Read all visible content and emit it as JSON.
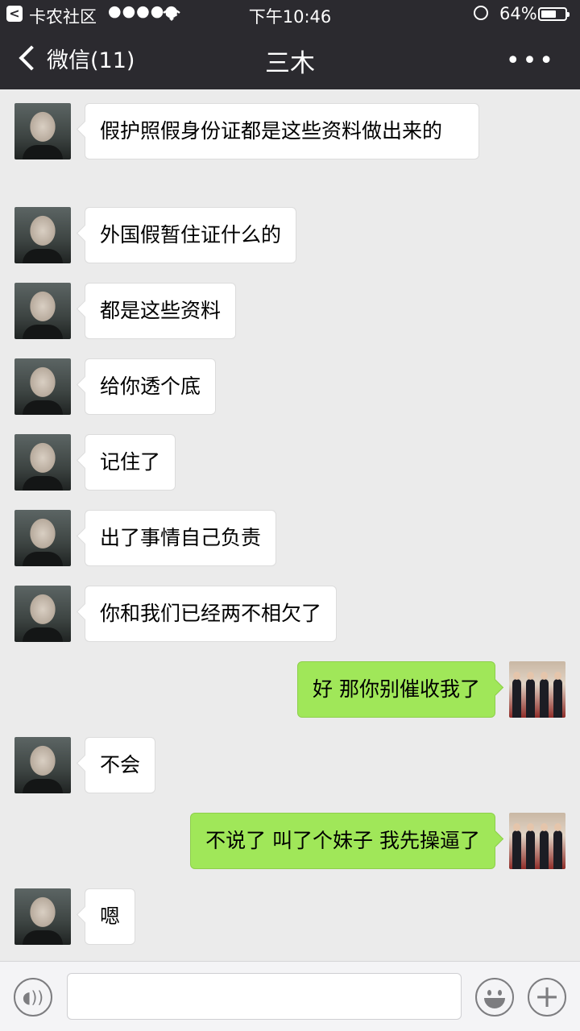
{
  "status_bar": {
    "back_app": "<",
    "carrier": "卡农社区",
    "signal": "●●●●●",
    "wifi": "wifi-icon",
    "time": "下午10:46",
    "battery_percent": "64%",
    "battery_level": 0.64
  },
  "nav": {
    "back_label": "微信(11)",
    "title": "三木",
    "more_label": "•••"
  },
  "messages": [
    {
      "side": "left",
      "text": "假护照假身份证都是这些资料做出来的"
    },
    {
      "side": "left",
      "text": "外国假暂住证什么的"
    },
    {
      "side": "left",
      "text": "都是这些资料"
    },
    {
      "side": "left",
      "text": "给你透个底"
    },
    {
      "side": "left",
      "text": "记住了"
    },
    {
      "side": "left",
      "text": "出了事情自己负责"
    },
    {
      "side": "left",
      "text": "你和我们已经两不相欠了"
    },
    {
      "side": "right",
      "text": "好 那你别催收我了"
    },
    {
      "side": "left",
      "text": "不会"
    },
    {
      "side": "right",
      "text": "不说了 叫了个妹子 我先操逼了"
    },
    {
      "side": "left",
      "text": "嗯"
    }
  ],
  "input_bar": {
    "voice_icon": "voice-icon",
    "voice_glyph": "◖))",
    "input_value": "",
    "emoji_icon": "emoji-icon",
    "plus_icon": "plus-icon",
    "plus_glyph": "+"
  },
  "colors": {
    "header_bg": "#2b2a2f",
    "chat_bg": "#ebebeb",
    "my_bubble": "#a0e759",
    "friend_bubble": "#ffffff"
  }
}
